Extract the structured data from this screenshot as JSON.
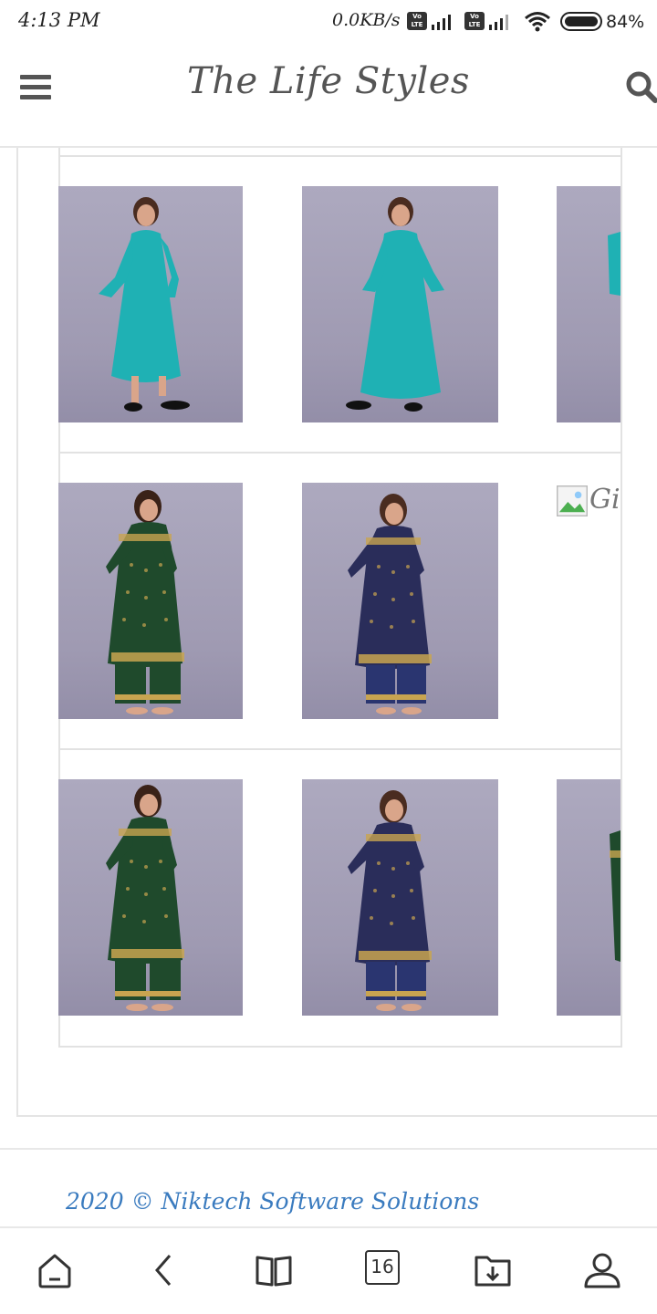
{
  "status_bar": {
    "time": "4:13 PM",
    "network_speed": "0.0KB/s",
    "volte_label": "Vo LTE",
    "battery": "84%"
  },
  "header": {
    "title": "The Life Styles",
    "menu_icon": "hamburger-menu-icon",
    "search_icon": "search-icon"
  },
  "gallery": {
    "broken_image_alt": "Gir",
    "colors": {
      "teal_dress": "#1fb1b4",
      "green_kurta": "#1f4a2c",
      "navy_kurta": "#2a2d5a",
      "gold_print": "#c8a450",
      "backdrop": "#a39eb6"
    }
  },
  "footer": {
    "copyright": "2020 © Niktech Software Solutions"
  },
  "bottom_nav": {
    "home_icon": "home-icon",
    "back_icon": "back-icon",
    "bookmarks_icon": "book-icon",
    "tabs_count": "16",
    "downloads_icon": "download-icon",
    "profile_icon": "profile-icon"
  }
}
